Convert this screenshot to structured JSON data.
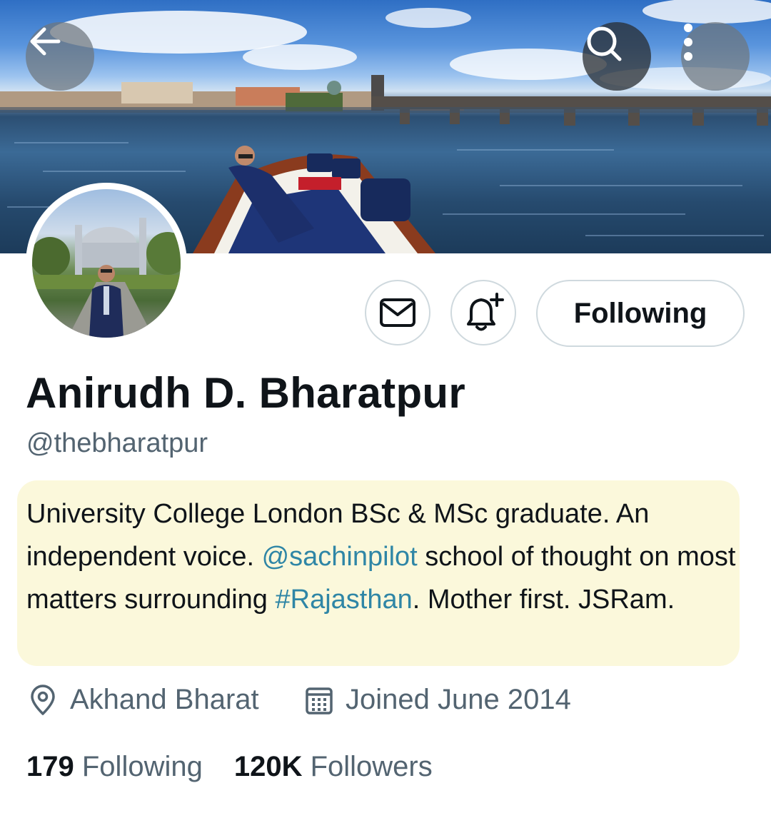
{
  "profile": {
    "name": "Anirudh D. Bharatpur",
    "handle": "@thebharatpur",
    "bio": {
      "part1": "University College London BSc & MSc graduate. An independent voice. ",
      "mention": "@sachinpilot",
      "part2": " school of thought on most matters surrounding ",
      "hashtag": "#Rajasthan",
      "part3": ". Mother first. JSRam."
    },
    "location": "Akhand Bharat",
    "joined": "Joined June 2014",
    "stats": {
      "following_count": "179",
      "following_label": "Following",
      "followers_count": "120K",
      "followers_label": "Followers"
    }
  },
  "actions": {
    "following_button": "Following"
  },
  "icons": {
    "back": "arrow-left-icon",
    "search": "search-icon",
    "more": "more-vertical-icon",
    "message": "envelope-icon",
    "notify": "bell-plus-icon",
    "location": "location-pin-icon",
    "calendar": "calendar-icon"
  },
  "colors": {
    "link": "#2f86a6",
    "secondary_text": "#536471",
    "bio_highlight": "#fbf8db",
    "border": "#cfd9de"
  }
}
